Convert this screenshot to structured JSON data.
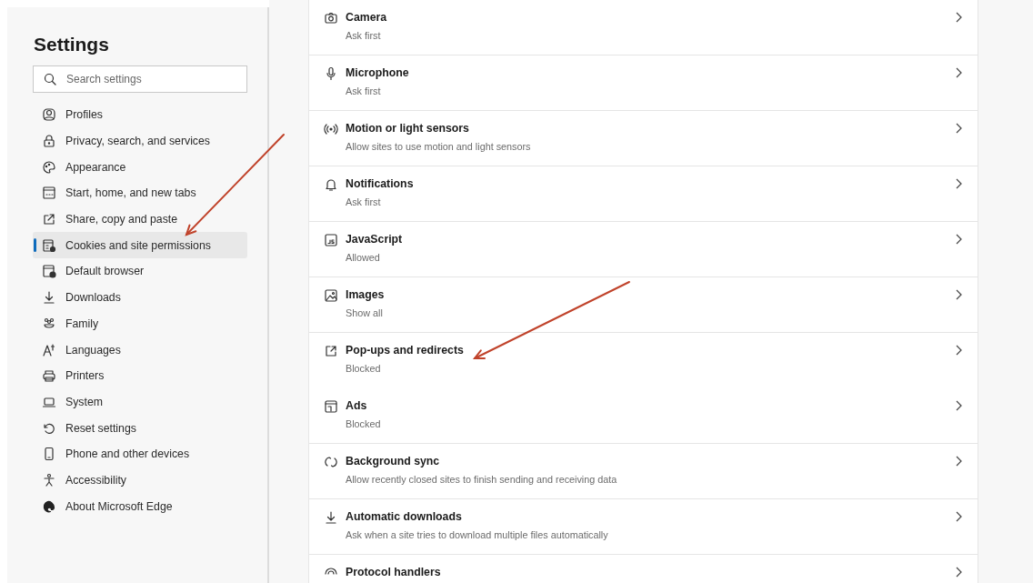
{
  "sidebar": {
    "title": "Settings",
    "search": {
      "placeholder": "Search settings"
    },
    "items": [
      {
        "label": "Profiles",
        "selected": false
      },
      {
        "label": "Privacy, search, and services",
        "selected": false
      },
      {
        "label": "Appearance",
        "selected": false
      },
      {
        "label": "Start, home, and new tabs",
        "selected": false
      },
      {
        "label": "Share, copy and paste",
        "selected": false
      },
      {
        "label": "Cookies and site permissions",
        "selected": true
      },
      {
        "label": "Default browser",
        "selected": false
      },
      {
        "label": "Downloads",
        "selected": false
      },
      {
        "label": "Family",
        "selected": false
      },
      {
        "label": "Languages",
        "selected": false
      },
      {
        "label": "Printers",
        "selected": false
      },
      {
        "label": "System",
        "selected": false
      },
      {
        "label": "Reset settings",
        "selected": false
      },
      {
        "label": "Phone and other devices",
        "selected": false
      },
      {
        "label": "Accessibility",
        "selected": false
      },
      {
        "label": "About Microsoft Edge",
        "selected": false
      }
    ]
  },
  "permissions": [
    {
      "title": "Camera",
      "subtitle": "Ask first",
      "divider_below": true
    },
    {
      "title": "Microphone",
      "subtitle": "Ask first",
      "divider_below": true
    },
    {
      "title": "Motion or light sensors",
      "subtitle": "Allow sites to use motion and light sensors",
      "divider_below": true
    },
    {
      "title": "Notifications",
      "subtitle": "Ask first",
      "divider_below": true
    },
    {
      "title": "JavaScript",
      "subtitle": "Allowed",
      "divider_below": true
    },
    {
      "title": "Images",
      "subtitle": "Show all",
      "divider_below": true
    },
    {
      "title": "Pop-ups and redirects",
      "subtitle": "Blocked",
      "divider_below": false
    },
    {
      "title": "Ads",
      "subtitle": "Blocked",
      "divider_below": true
    },
    {
      "title": "Background sync",
      "subtitle": "Allow recently closed sites to finish sending and receiving data",
      "divider_below": true
    },
    {
      "title": "Automatic downloads",
      "subtitle": "Ask when a site tries to download multiple files automatically",
      "divider_below": true
    },
    {
      "title": "Protocol handlers"
    }
  ]
}
